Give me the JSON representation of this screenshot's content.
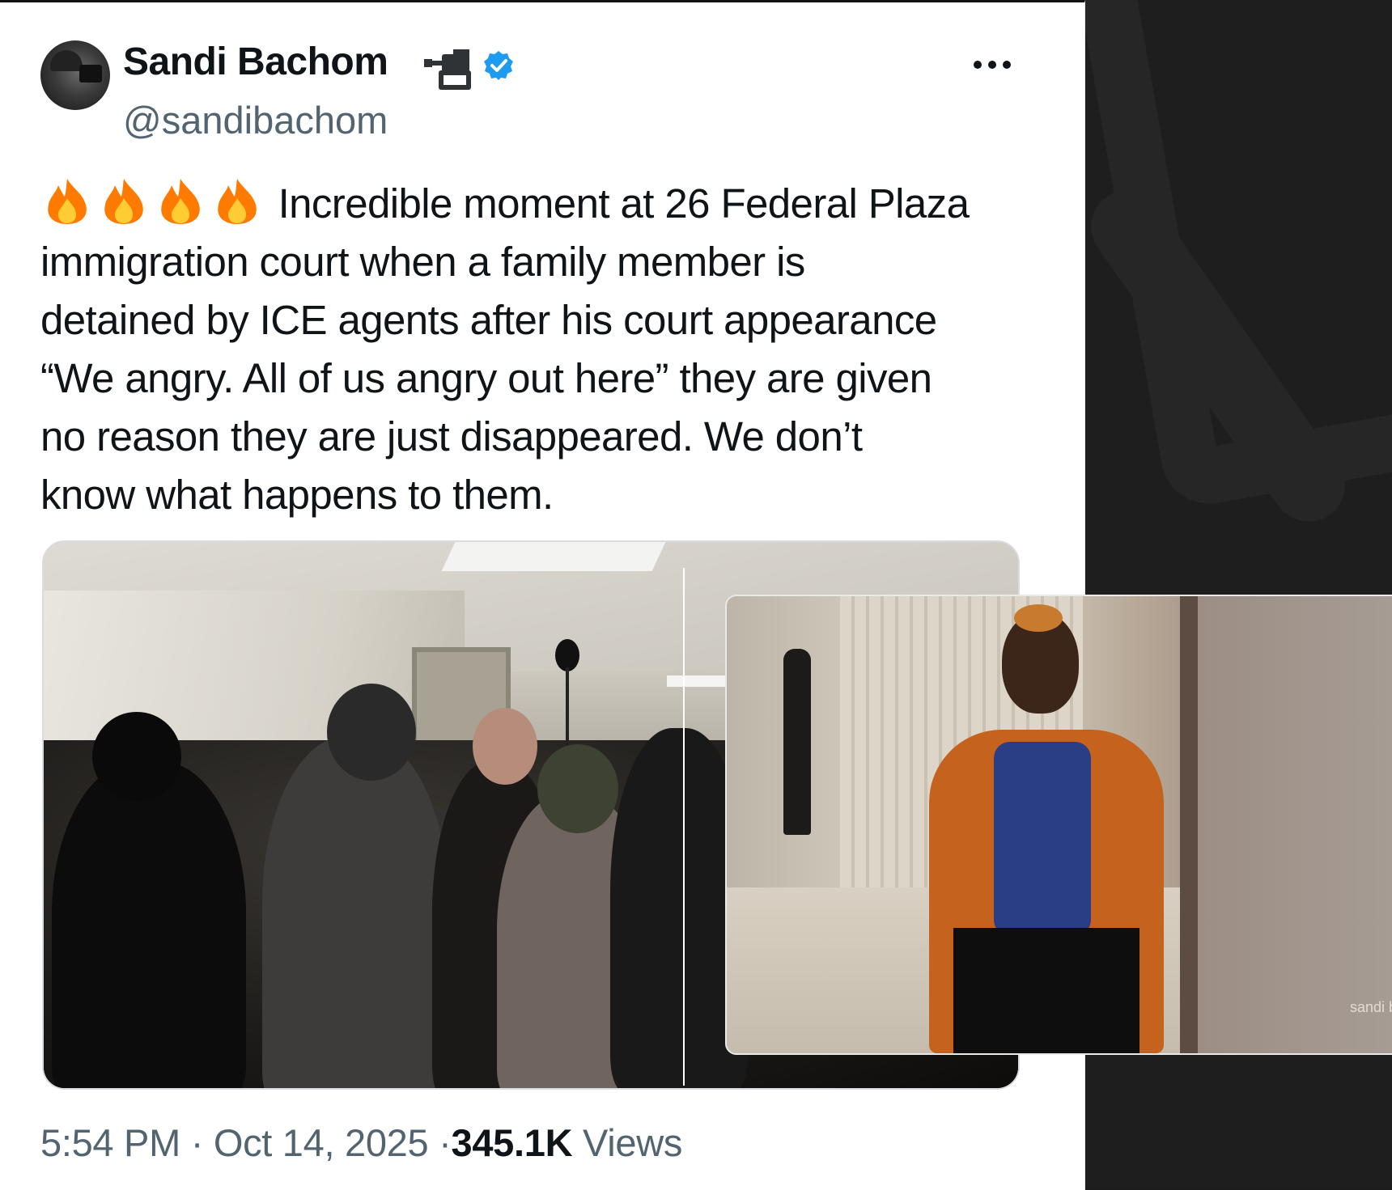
{
  "tweet": {
    "author_name": "Sandi Bachom",
    "handle": "@sandibachom",
    "lines": [
      "Incredible moment at 26 Federal Plaza",
      "immigration court when a family member is",
      "detained by ICE agents after his court appearance",
      "“We angry. All of us angry out here” they are given",
      "no reason they are just disappeared. We don’t",
      "know what happens to them."
    ],
    "time": "5:54 PM",
    "date": "Oct 14, 2025",
    "separator": "·",
    "views_count": "345.1K",
    "views_label": "Views",
    "inset_watermark": "sandi b",
    "emoji_icons": [
      "fire-icon",
      "fire-icon",
      "fire-icon",
      "fire-icon"
    ]
  },
  "icons": {
    "camera": "movie-camera-icon",
    "verified": "verified-badge-icon",
    "more": "more-options-icon"
  },
  "colors": {
    "verified_blue": "#1d9bf0",
    "secondary_text": "#536471",
    "primary_text": "#0f1419"
  }
}
